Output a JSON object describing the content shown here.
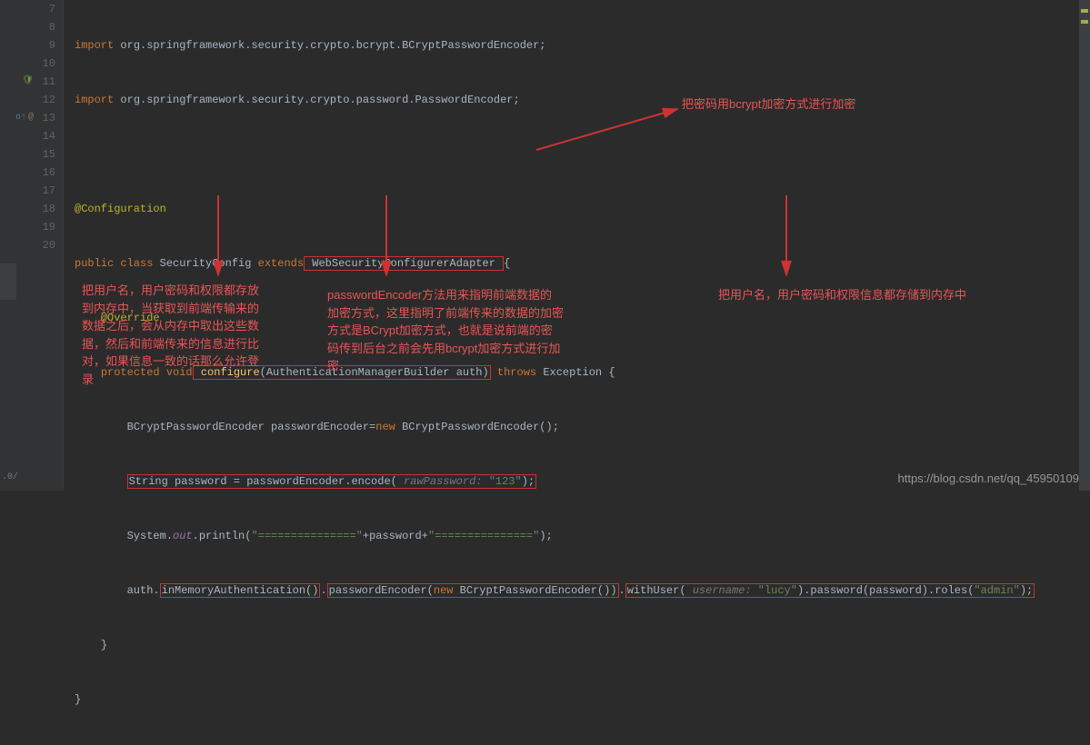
{
  "gutter": {
    "lines": [
      "7",
      "8",
      "9",
      "10",
      "11",
      "12",
      "13",
      "14",
      "15",
      "16",
      "17",
      "18",
      "19",
      "20"
    ]
  },
  "code": {
    "l7_prefix": "import",
    "l7_rest": " org.springframework.security.crypto.bcrypt.BCryptPasswordEncoder;",
    "l8_prefix": "import",
    "l8_rest": " org.springframework.security.crypto.password.PasswordEncoder;",
    "l10": "@Configuration",
    "l11_kw1": "public class",
    "l11_name": " SecurityConfig ",
    "l11_kw2": "extends",
    "l11_ext": " WebSecurityConfigurerAdapter ",
    "l11_brace": "{",
    "l12": "@Override",
    "l13_kw1": "protected void",
    "l13_method": " configure",
    "l13_params": "(AuthenticationManagerBuilder auth)",
    "l13_kw2": " throws",
    "l13_exc": " Exception {",
    "l14_a": "BCryptPasswordEncoder passwordEncoder=",
    "l14_new": "new",
    "l14_b": " BCryptPasswordEncoder();",
    "l15_a": "String password = passwordEncoder.encode(",
    "l15_hint": " rawPassword: ",
    "l15_str": "\"123\"",
    "l15_c": ");",
    "l16_a": "System.",
    "l16_out": "out",
    "l16_b": ".println(",
    "l16_s1": "\"===============\"",
    "l16_plus": "+password+",
    "l16_s2": "\"===============\"",
    "l16_c": ");",
    "l17_a": "auth.",
    "l17_m1": "inMemoryAuthentication()",
    "l17_dot1": ".",
    "l17_m2": "passwordEncoder(",
    "l17_new": "new",
    "l17_m2b": " BCryptPasswordEncoder())",
    "l17_dot2": ".",
    "l17_m3": "withUser(",
    "l17_hint2": " username: ",
    "l17_str2": "\"lucy\"",
    "l17_m3c": ").password(password).roles(",
    "l17_str3": "\"admin\"",
    "l17_end": ");",
    "l18": "}",
    "l19": "}"
  },
  "annotations": {
    "top_right": "把密码用bcrypt加密方式进行加密",
    "bottom_left": "把用户名，用户密码和权限都存放到内存中，当获取到前端传输来的数据之后，会从内存中取出这些数据，然后和前端传来的信息进行比对，如果信息一致的话那么允许登录",
    "bottom_mid": "passwordEncoder方法用来指明前端数据的加密方式，这里指明了前端传来的数据的加密方式是BCrypt加密方式，也就是说前端的密码传到后台之前会先用bcrypt加密方式进行加密",
    "bottom_right": "把用户名，用户密码和权限信息都存储到内存中"
  },
  "watermark": "https://blog.csdn.net/qq_45950109",
  "bottom_info": ".0/"
}
